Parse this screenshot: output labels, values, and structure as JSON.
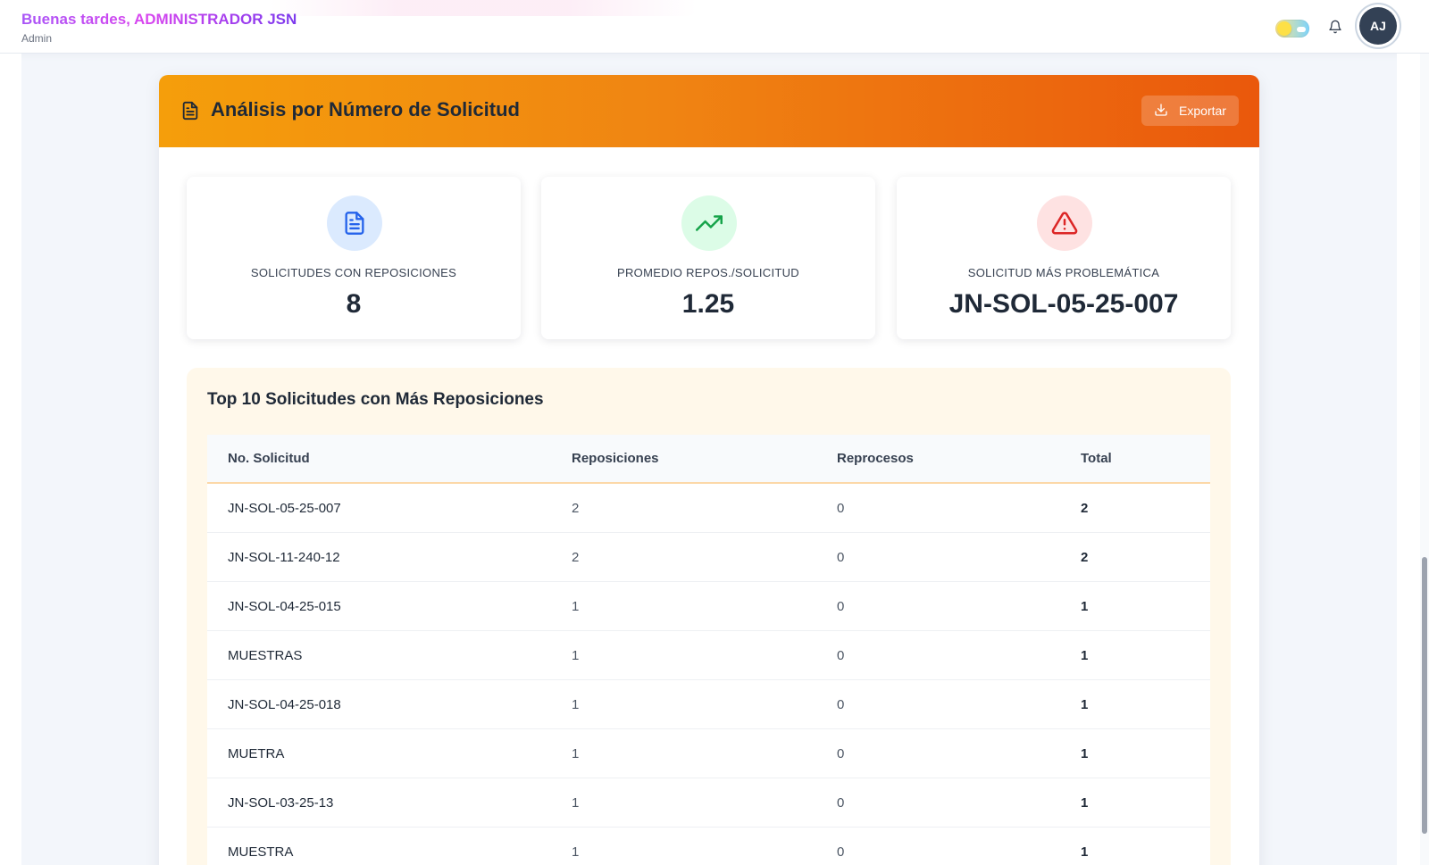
{
  "header": {
    "greeting": "Buenas tardes, ADMINISTRADOR JSN",
    "role": "Admin",
    "avatar_initials": "AJ",
    "icons": [
      "theme-toggle",
      "bell-icon"
    ]
  },
  "panel": {
    "title": "Análisis por Número de Solicitud",
    "export_label": "Exportar",
    "header_gradient": [
      "#f59e0b",
      "#ea580c"
    ]
  },
  "stats": [
    {
      "label": "SOLICITUDES CON REPOSICIONES",
      "value": "8",
      "icon": "document-icon",
      "color": "#2563eb",
      "bg": "#dbeafe"
    },
    {
      "label": "PROMEDIO REPOS./SOLICITUD",
      "value": "1.25",
      "icon": "trending-up-icon",
      "color": "#16a34a",
      "bg": "#dcfce7"
    },
    {
      "label": "SOLICITUD MÁS PROBLEMÁTICA",
      "value": "JN-SOL-05-25-007",
      "icon": "alert-triangle-icon",
      "color": "#dc2626",
      "bg": "#fee2e2"
    }
  ],
  "top_table": {
    "title": "Top 10 Solicitudes con Más Reposiciones",
    "columns": [
      "No. Solicitud",
      "Reposiciones",
      "Reprocesos",
      "Total"
    ],
    "rows": [
      [
        "JN-SOL-05-25-007",
        "2",
        "0",
        "2"
      ],
      [
        "JN-SOL-11-240-12",
        "2",
        "0",
        "2"
      ],
      [
        "JN-SOL-04-25-015",
        "1",
        "0",
        "1"
      ],
      [
        "MUESTRAS",
        "1",
        "0",
        "1"
      ],
      [
        "JN-SOL-04-25-018",
        "1",
        "0",
        "1"
      ],
      [
        "MUETRA",
        "1",
        "0",
        "1"
      ],
      [
        "JN-SOL-03-25-13",
        "1",
        "0",
        "1"
      ],
      [
        "MUESTRA",
        "1",
        "0",
        "1"
      ]
    ]
  }
}
